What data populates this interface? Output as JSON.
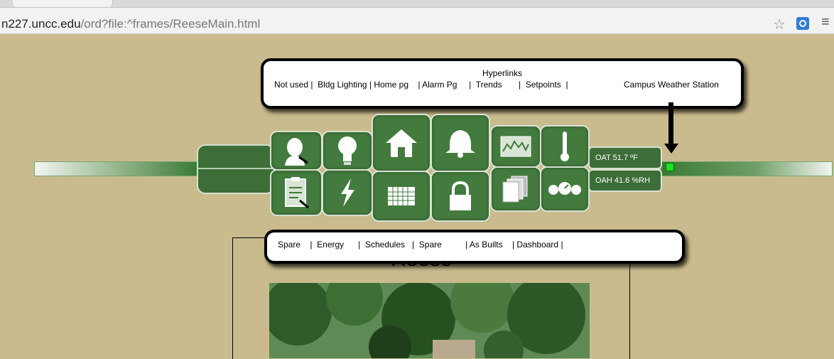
{
  "browser": {
    "url_host": "n227.uncc.edu",
    "url_path": "/ord?file:^frames/ReeseMain.html",
    "icons": [
      "star-icon",
      "extension-icon",
      "menu-icon"
    ]
  },
  "top_callout": {
    "title": "Hyperlinks",
    "links_line": "Not used |  Bldg Lighting | Home pg    | Alarm Pg     |  Trends       |  Setpoints  |",
    "weather_link": "Campus Weather Station"
  },
  "bottom_callout": {
    "links_line": "Spare    |  Energy      |  Schedules   |  Spare          | As Builts    | Dashboard |"
  },
  "status": {
    "oat": "OAT  51.7 ºF",
    "oah": "OAH 41.6 %RH"
  },
  "buttons": [
    {
      "name": "person-icon"
    },
    {
      "name": "lightbulb-icon"
    },
    {
      "name": "home-icon"
    },
    {
      "name": "bell-icon"
    },
    {
      "name": "trend-graph-icon"
    },
    {
      "name": "thermometer-icon"
    },
    {
      "name": "clipboard-icon"
    },
    {
      "name": "lightning-icon"
    },
    {
      "name": "calendar-grid-icon"
    },
    {
      "name": "padlock-icon"
    },
    {
      "name": "documents-icon"
    },
    {
      "name": "gauges-icon"
    }
  ],
  "frame": {
    "title": "Reese"
  },
  "colors": {
    "background": "#c9bb8d",
    "panel_green": "#3d6e38",
    "status_indicator": "#1ee01e"
  }
}
